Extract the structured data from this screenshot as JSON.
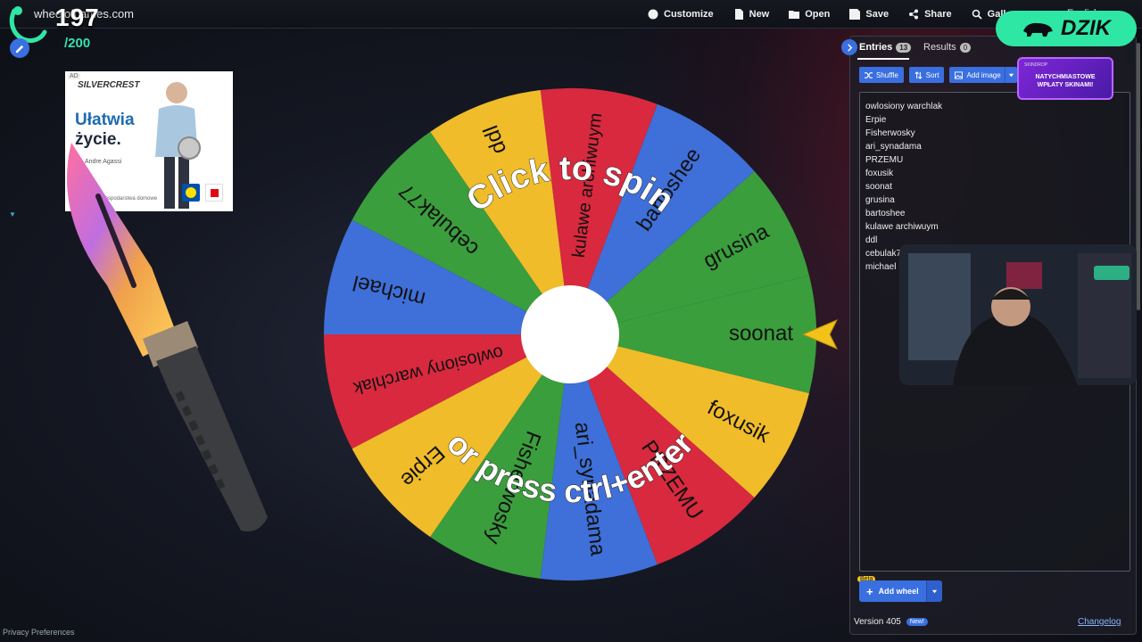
{
  "site": {
    "domain": "wheelofnames.com"
  },
  "overlay": {
    "counter": "197",
    "counter_max": "/200",
    "dzik_label": "DZIK"
  },
  "nav": [
    {
      "label": "Customize",
      "icon": "palette-icon"
    },
    {
      "label": "New",
      "icon": "file-icon"
    },
    {
      "label": "Open",
      "icon": "folder-icon"
    },
    {
      "label": "Save",
      "icon": "save-icon"
    },
    {
      "label": "Share",
      "icon": "share-icon"
    },
    {
      "label": "Gallery",
      "icon": "search-icon"
    }
  ],
  "language": "English",
  "ad": {
    "tag": "AD",
    "brand": "SILVERCREST",
    "headline_1": "Ułatwia",
    "headline_2": "życie.",
    "person": "Andre Agassi",
    "foot": "Gospodarstwa domowe"
  },
  "wheel": {
    "entries": [
      "grusina",
      "bartoshee",
      "kulawe archiwuym",
      "ddl",
      "cebulak77",
      "michael",
      "owlosiony warchlak",
      "Erpie",
      "Fisherwosky",
      "ari_synadama",
      "PRZEMU",
      "foxusik",
      "soonat"
    ],
    "colors": [
      "#3a9e3c",
      "#3f6fd8",
      "#d8293e",
      "#f0bc2a"
    ],
    "center_color": "#ffffff",
    "prompt_top": "Click to spin",
    "prompt_bottom": "or press ctrl+enter"
  },
  "panel": {
    "tab_entries": "Entries",
    "entries_count": "13",
    "tab_results": "Results",
    "results_count": "0",
    "shuffle": "Shuffle",
    "sort": "Sort",
    "add_image": "Add image",
    "entries": [
      "owlosiony warchlak",
      "Erpie",
      "Fisherwosky",
      "ari_synadama",
      "PRZEMU",
      "foxusik",
      "soonat",
      "grusina",
      "bartoshee",
      "kulawe archiwuym",
      "ddl",
      "cebulak77",
      "michael"
    ],
    "beta": "Beta",
    "add_wheel": "Add wheel",
    "version": "Version 405",
    "new_badge": "New!",
    "changelog": "Changelog"
  },
  "promo": {
    "top": "SKINDROP",
    "line1": "NATYCHMIASTOWE",
    "line2": "WPŁATY SKINAMI!"
  },
  "footer": {
    "privacy": "Privacy Preferences"
  }
}
